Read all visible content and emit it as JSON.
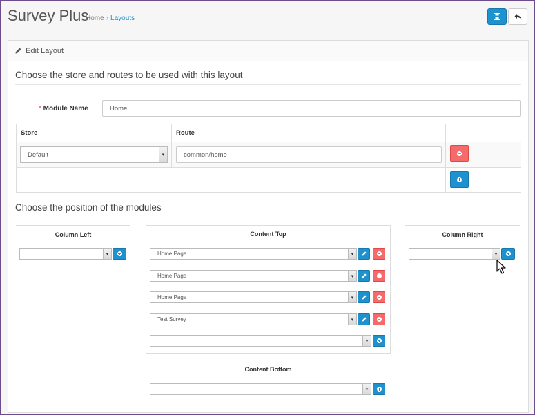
{
  "header": {
    "title": "Survey Plus",
    "breadcrumb": {
      "home": "Home",
      "current": "Layouts"
    },
    "colors": {
      "primary": "#1e91cf",
      "danger": "#f56b6b"
    }
  },
  "panel": {
    "heading": "Edit Layout",
    "heading_icon": "pencil-icon",
    "section_store": "Choose the store and routes to be used with this layout",
    "section_modules": "Choose the position of the modules"
  },
  "form": {
    "module_name_label": "Module Name",
    "module_name_value": "Home"
  },
  "route_table": {
    "headers": {
      "store": "Store",
      "route": "Route"
    },
    "rows": [
      {
        "store": "Default",
        "route": "common/home"
      }
    ]
  },
  "positions": {
    "column_left": {
      "title": "Column Left",
      "selected": ""
    },
    "content_top": {
      "title": "Content Top",
      "modules": [
        "Home Page",
        "Home Page",
        "Home Page",
        "Test Survey"
      ],
      "new_selected": ""
    },
    "column_right": {
      "title": "Column Right",
      "selected": ""
    },
    "content_bottom": {
      "title": "Content Bottom",
      "selected": ""
    }
  }
}
